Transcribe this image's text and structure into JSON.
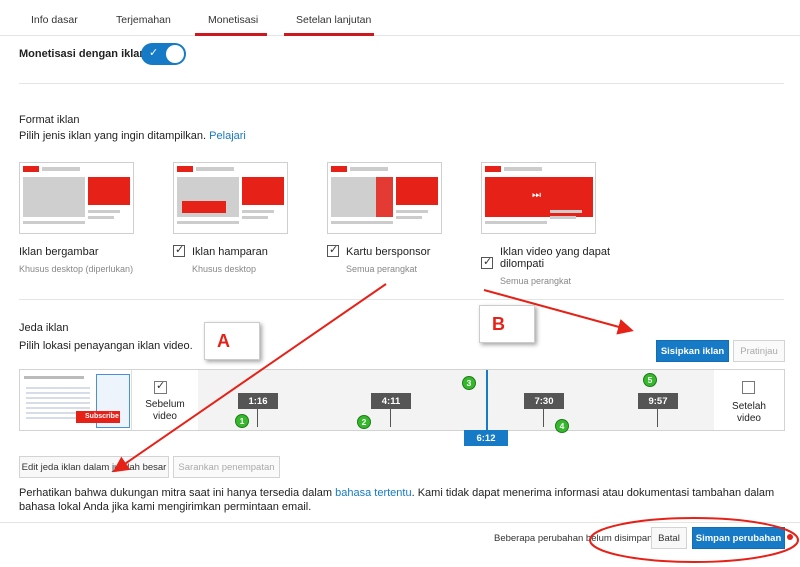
{
  "tabs": [
    {
      "label": "Info dasar",
      "active": false
    },
    {
      "label": "Terjemahan",
      "active": false
    },
    {
      "label": "Monetisasi",
      "active": true
    },
    {
      "label": "Setelan lanjutan",
      "active": true
    }
  ],
  "monetization": {
    "label": "Monetisasi dengan iklan",
    "enabled": true,
    "toggle_glyph": "✓"
  },
  "ad_format": {
    "title": "Format iklan",
    "description": "Pilih jenis iklan yang ingin ditampilkan.",
    "learn_link": "Pelajari",
    "items": [
      {
        "name": "Iklan bergambar",
        "sub": "Khusus desktop (diperlukan)",
        "checked": false,
        "checkbox": false,
        "icon": "display-ad-icon"
      },
      {
        "name": "Iklan hamparan",
        "sub": "Khusus desktop",
        "checked": true,
        "checkbox": true,
        "icon": "overlay-ad-icon"
      },
      {
        "name": "Kartu bersponsor",
        "sub": "Semua perangkat",
        "checked": true,
        "checkbox": true,
        "icon": "sponsored-card-icon"
      },
      {
        "name_line1": "Iklan video yang dapat",
        "name_line2": "dilompati",
        "sub": "Semua perangkat",
        "checked": true,
        "checkbox": true,
        "icon": "skippable-video-ad-icon"
      }
    ],
    "check_glyph": "✓",
    "skip_glyph": "⏭"
  },
  "ad_breaks": {
    "title": "Jeda iklan",
    "description": "Pilih lokasi penayangan iklan video.",
    "insert_button": "Sisipkan iklan",
    "preview_button": "Pratinjau",
    "pre_roll_line1": "Sebelum",
    "pre_roll_line2": "video",
    "pre_roll_checked": true,
    "post_roll_line1": "Setelah",
    "post_roll_line2": "video",
    "post_roll_checked": false,
    "thumbnail_text": "Subscribe",
    "markers": [
      "1:16",
      "4:11",
      "7:30",
      "9:57"
    ],
    "cursor": "6:12",
    "edit_bulk_button": "Edit jeda iklan dalam jumlah besar",
    "suggest_button": "Sarankan penempatan"
  },
  "annotations": {
    "callout_a": "A",
    "callout_b": "B",
    "numbers": [
      "1",
      "2",
      "3",
      "4",
      "5"
    ],
    "color": "#e62117"
  },
  "notice": {
    "part1": "Perhatikan bahwa dukungan mitra saat ini hanya tersedia dalam ",
    "link": "bahasa tertentu",
    "part2": ". Kami tidak dapat menerima informasi atau dokumentasi tambahan dalam bahasa lokal Anda jika kami mengirimkan permintaan email."
  },
  "footer": {
    "unsaved_text": "Beberapa perubahan belum disimpan.",
    "cancel_button": "Batal",
    "save_button": "Simpan perubahan"
  },
  "colors": {
    "accent": "#167ac6",
    "youtube_red": "#e62117",
    "tab_underline": "#cc181e",
    "marker_number": "#35b82c"
  }
}
